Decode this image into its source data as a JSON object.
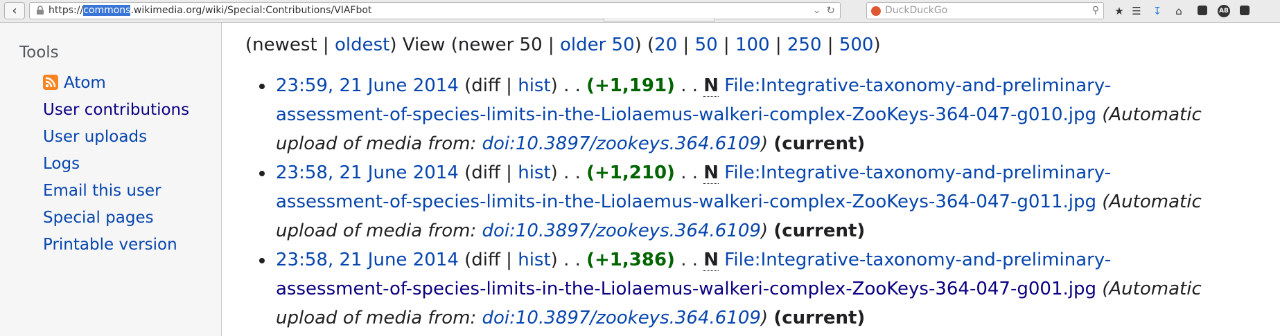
{
  "browser": {
    "url_before": "https://",
    "url_selected": "commons",
    "url_after": ".wikimedia.org/wiki/Special:Contributions/VIAFbot",
    "search_placeholder": "DuckDuckGo",
    "toolbar_icons": [
      "bookmark-star-icon",
      "reading-list-icon",
      "download-icon",
      "home-icon",
      "extension-icon",
      "adblock-icon",
      "menu-square-icon"
    ],
    "adblock_label": "AB"
  },
  "sidebar": {
    "heading": "Tools",
    "items": [
      {
        "label": "Atom",
        "icon": "rss-icon"
      },
      {
        "label": "User contributions"
      },
      {
        "label": "User uploads"
      },
      {
        "label": "Logs"
      },
      {
        "label": "Email this user"
      },
      {
        "label": "Special pages"
      },
      {
        "label": "Printable version"
      }
    ]
  },
  "nav": {
    "newest": "newest",
    "oldest": "oldest",
    "view": "View",
    "newer": "newer 50",
    "older": "older 50",
    "limits": [
      "20",
      "50",
      "100",
      "250",
      "500"
    ]
  },
  "contributions": [
    {
      "timestamp": "23:59, 21 June 2014",
      "diff": "diff",
      "hist": "hist",
      "size": "(+1,191)",
      "new_flag": "N",
      "title_part1": "File:Integrative-taxonomy-and-preliminary-",
      "title_part2": "assessment-of-species-limits-in-the-Liolaemus-walkeri-complex-ZooKeys-364-047-g010.jpg",
      "comment_before": "(Automatic",
      "comment_mid": "upload of media from: ",
      "comment_link": "doi:10.3897/zookeys.364.6109",
      "comment_after": ")",
      "current": "(current)"
    },
    {
      "timestamp": "23:58, 21 June 2014",
      "diff": "diff",
      "hist": "hist",
      "size": "(+1,210)",
      "new_flag": "N",
      "title_part1": "File:Integrative-taxonomy-and-preliminary-",
      "title_part2": "assessment-of-species-limits-in-the-Liolaemus-walkeri-complex-ZooKeys-364-047-g011.jpg",
      "comment_before": "(Automatic",
      "comment_mid": "upload of media from: ",
      "comment_link": "doi:10.3897/zookeys.364.6109",
      "comment_after": ")",
      "current": "(current)"
    },
    {
      "timestamp": "23:58, 21 June 2014",
      "diff": "diff",
      "hist": "hist",
      "size": "(+1,386)",
      "new_flag": "N",
      "title_part1": "File:Integrative-taxonomy-and-preliminary-",
      "title_part2": "assessment-of-species-limits-in-the-Liolaemus-walkeri-complex-ZooKeys-364-047-g001.jpg",
      "comment_before": "(Automatic",
      "comment_mid": "upload of media from: ",
      "comment_link": "doi:10.3897/zookeys.364.6109",
      "comment_after": ")",
      "current": "(current)"
    }
  ],
  "colors": {
    "link": "#0645ad",
    "visited_link": "#0b0080",
    "positive_size": "#006400",
    "rss": "#f78422"
  }
}
